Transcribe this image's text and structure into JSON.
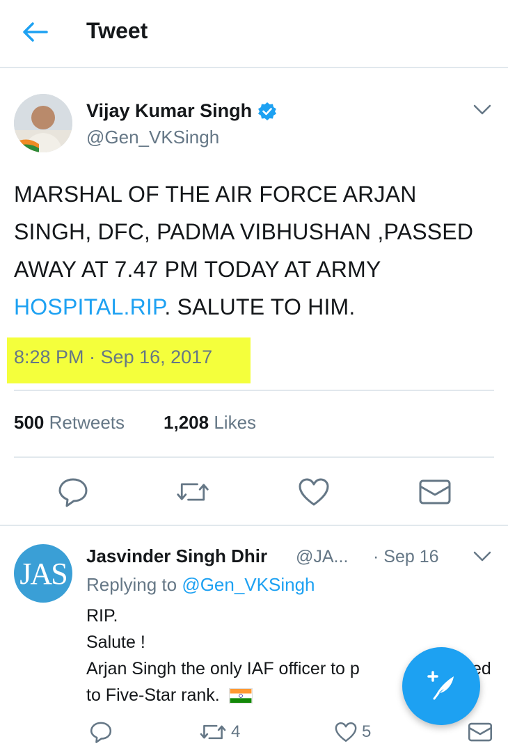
{
  "header": {
    "title": "Tweet",
    "back_icon": "arrow-left-icon"
  },
  "tweet": {
    "author_name": "Vijay Kumar Singh",
    "author_handle": "@Gen_VKSingh",
    "verified": true,
    "text_part1": "MARSHAL OF THE AIR FORCE ARJAN SINGH, DFC, PADMA VIBHUSHAN ,PASSED AWAY AT 7.47  PM  TODAY AT ARMY ",
    "text_link": "HOSPITAL.RIP",
    "text_part2": ". SALUTE TO HIM.",
    "timestamp": "8:28 PM · Sep 16, 2017",
    "retweets_count": "500",
    "retweets_label": "Retweets",
    "likes_count": "1,208",
    "likes_label": "Likes"
  },
  "reply": {
    "avatar_text": "JAS",
    "author_name": "Jasvinder Singh Dhir",
    "author_handle": "@JA...",
    "date": "· Sep 16",
    "replying_prefix": "Replying to",
    "replying_to": "@Gen_VKSingh",
    "line1": "RIP.",
    "line2": "Salute !",
    "line3": "Arjan Singh the only IAF officer to p",
    "line3_tail": "ed",
    "line4": "to  Five-Star  rank.",
    "retweets": "4",
    "likes": "5"
  },
  "colors": {
    "accent": "#1da1f2",
    "secondary_text": "#657786",
    "highlight": "#f4ff3c",
    "divider": "#e1e8ed"
  }
}
